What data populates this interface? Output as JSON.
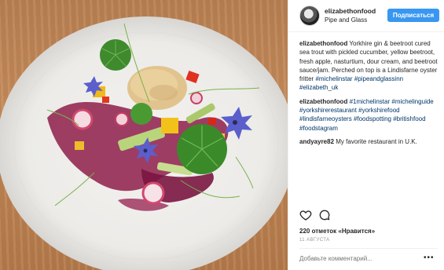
{
  "post": {
    "username": "elizabethonfood",
    "location": "Pipe and Glass",
    "follow_label": "Подписаться"
  },
  "comments": [
    {
      "author": "elizabethonfood",
      "text": " Yorkhire gin & beetroot cured sea trout with pickled cucumber, yellow beetroot, fresh apple, nasturtium, dour cream, and beetroot sauce/jam. Perched on top is a Lindisfarne oyster fritter ",
      "tags": [
        "#michelinstar",
        "#pipeandglassinn",
        "#elizabeth_uk"
      ]
    },
    {
      "author": "elizabethonfood",
      "text": " ",
      "tags": [
        "#1michelinstar",
        "#michelinguide",
        "#yorkshirerestaurant",
        "#yorkshirefood",
        "#lindisfarneoysters",
        "#foodspotting",
        "#britishfood",
        "#foodstagram"
      ]
    },
    {
      "author": "andyayre82",
      "text": " My favorite restaurant in U.K.",
      "tags": []
    }
  ],
  "actions": {
    "like_icon": "heart-icon",
    "comment_icon": "speech-bubble-icon"
  },
  "likes_text": "220 отметок «Нравится»",
  "date_text": "11 АВГУСТА",
  "add_comment_placeholder": "Добавьте комментарий...",
  "more_label": "•••",
  "colors": {
    "follow_button": "#3897f0",
    "hashtag": "#003569",
    "muted": "#999999"
  }
}
